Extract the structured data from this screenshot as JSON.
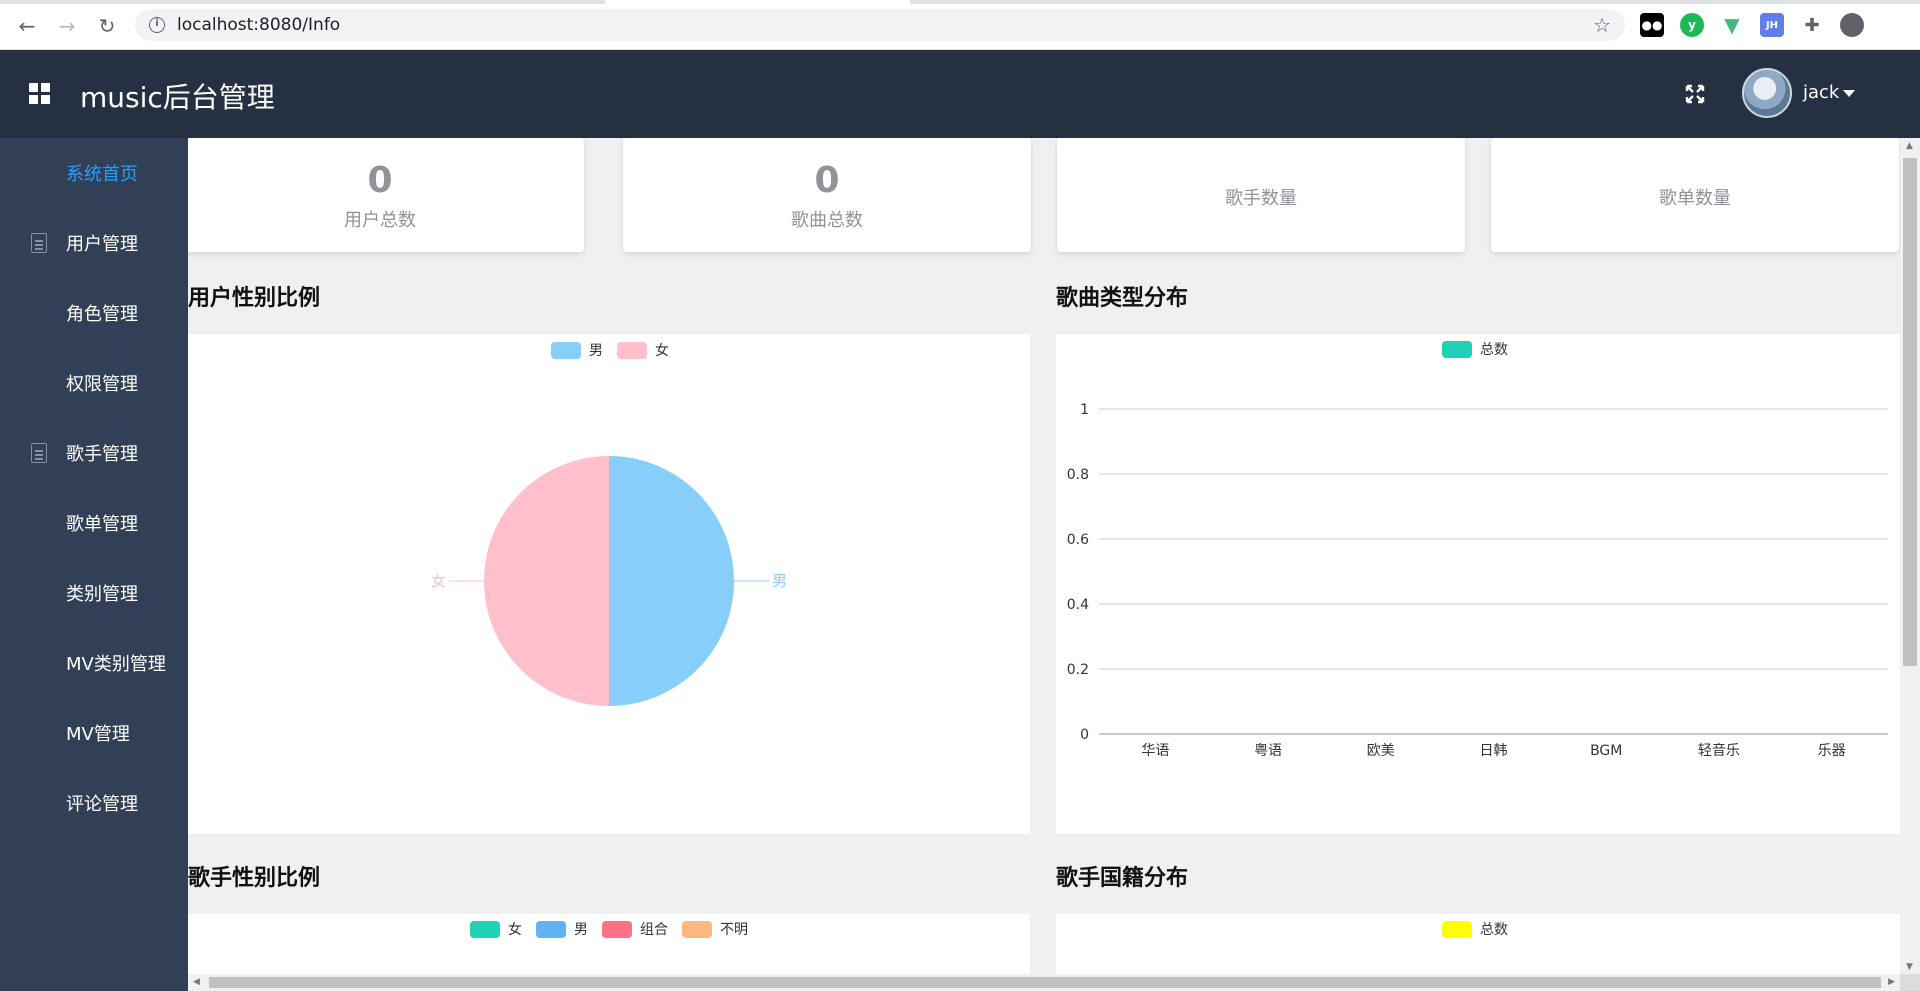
{
  "browser": {
    "url": "localhost:8080/Info",
    "extensions": [
      "tampermonkey-icon",
      "v-extension-icon",
      "vue-devtools-icon",
      "jh-icon",
      "puzzle-icon",
      "profile-icon"
    ],
    "jh_label": "JH"
  },
  "header": {
    "title": "music后台管理",
    "username": "jack"
  },
  "sidebar": {
    "items": [
      {
        "label": "系统首页",
        "active": true,
        "icon": ""
      },
      {
        "label": "用户管理",
        "active": false,
        "icon": "document-icon"
      },
      {
        "label": "角色管理",
        "active": false,
        "icon": ""
      },
      {
        "label": "权限管理",
        "active": false,
        "icon": ""
      },
      {
        "label": "歌手管理",
        "active": false,
        "icon": "document-icon"
      },
      {
        "label": "歌单管理",
        "active": false,
        "icon": ""
      },
      {
        "label": "类别管理",
        "active": false,
        "icon": ""
      },
      {
        "label": "MV类别管理",
        "active": false,
        "icon": ""
      },
      {
        "label": "MV管理",
        "active": false,
        "icon": ""
      },
      {
        "label": "评论管理",
        "active": false,
        "icon": ""
      }
    ],
    "accent_color": "#20a0ff"
  },
  "stats": [
    {
      "value": "0",
      "label": "用户总数"
    },
    {
      "value": "0",
      "label": "歌曲总数"
    },
    {
      "value": "",
      "label": "歌手数量"
    },
    {
      "value": "",
      "label": "歌单数量"
    }
  ],
  "sections": {
    "user_gender": "用户性别比例",
    "song_type": "歌曲类型分布",
    "singer_gender": "歌手性别比例",
    "singer_nation": "歌手国籍分布"
  },
  "chart_data": [
    {
      "type": "pie",
      "legend": [
        "男",
        "女"
      ],
      "slices": [
        {
          "label": "男",
          "value": 1,
          "color": "#87cefa"
        },
        {
          "label": "女",
          "value": 1,
          "color": "#ffc0cb"
        }
      ],
      "legend_placement": "top"
    },
    {
      "type": "bar",
      "legend": [
        "总数"
      ],
      "series_color": "#1fd2b5",
      "categories": [
        "华语",
        "粤语",
        "欧美",
        "日韩",
        "BGM",
        "轻音乐",
        "乐器"
      ],
      "series": [
        {
          "name": "总数",
          "values": [
            0,
            0,
            0,
            0,
            0,
            0,
            0
          ]
        }
      ],
      "ylim": [
        0,
        1
      ],
      "yticks": [
        "0",
        "0.2",
        "0.4",
        "0.6",
        "0.8",
        "1"
      ],
      "grid": true,
      "legend_placement": "top"
    },
    {
      "type": "pie",
      "legend": [
        {
          "label": "女",
          "color": "#1fd2b5"
        },
        {
          "label": "男",
          "color": "#5fb3f5"
        },
        {
          "label": "组合",
          "color": "#ff7184"
        },
        {
          "label": "不明",
          "color": "#ffb980"
        }
      ],
      "legend_placement": "top"
    },
    {
      "type": "bar",
      "legend": [
        {
          "label": "总数",
          "color": "#ffff00"
        }
      ],
      "legend_placement": "top"
    }
  ]
}
